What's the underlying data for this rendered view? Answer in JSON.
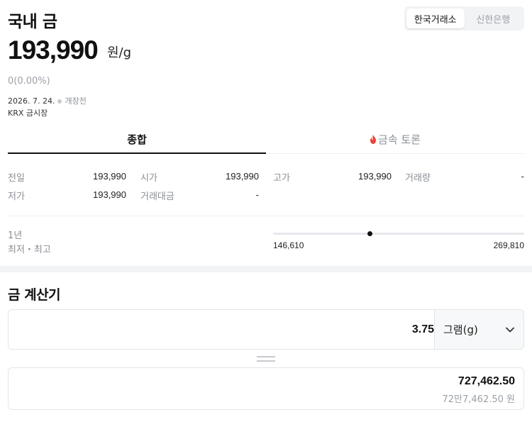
{
  "header": {
    "title": "국내 금",
    "source_options": [
      "한국거래소",
      "신한은행"
    ],
    "selected_source": "한국거래소"
  },
  "price": {
    "value": "193,990",
    "unit": "원/g",
    "change": "0(0.00%)",
    "date": "2026. 7. 24.",
    "status": "개장전",
    "market": "KRX 금시장"
  },
  "tabs": [
    {
      "label": "종합",
      "active": true
    },
    {
      "label": "금속 토론",
      "active": false,
      "icon": "fire-icon"
    }
  ],
  "stats": {
    "prev_close": {
      "label": "전일",
      "value": "193,990"
    },
    "open": {
      "label": "시가",
      "value": "193,990"
    },
    "high": {
      "label": "고가",
      "value": "193,990"
    },
    "volume": {
      "label": "거래량",
      "value": "-"
    },
    "low": {
      "label": "저가",
      "value": "193,990"
    },
    "turnover": {
      "label": "거래대금",
      "value": "-"
    }
  },
  "range": {
    "label_top": "1년",
    "label_bottom": "최저・최고",
    "low": "146,610",
    "high": "269,810",
    "low_num": 146610,
    "high_num": 269810,
    "current_num": 193990
  },
  "calculator": {
    "title": "금 계산기",
    "input_value": "3.75",
    "unit_selected": "그램(g)",
    "result": "727,462.50",
    "result_korean": "72만7,462.50 원"
  },
  "colors": {
    "accent_fire": "#f04438",
    "muted": "#8a8f95",
    "text": "#111111"
  }
}
